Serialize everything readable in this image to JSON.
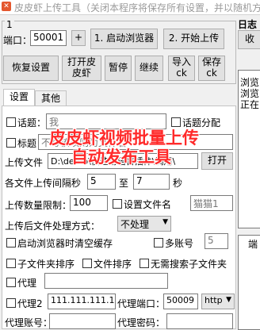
{
  "window": {
    "title": "皮皮虾上传工具（关闭本程序将保存所有设置，并以随机方式"
  },
  "right_panel": {
    "header": "日志",
    "button": "收",
    "log_lines": [
      "浏览",
      "浏览",
      "正在"
    ],
    "bottom_label": "端"
  },
  "toolbar": {
    "index_value": "1",
    "port_label": "端口：",
    "port_value": "50001",
    "plus_label": "+",
    "start_browser_label": "1. 启动浏览器",
    "start_upload_label": "2. 开始上传",
    "restore_label": "恢复设置",
    "open_browser_label": "打开皮\n皮虾",
    "pause_label": "暂停",
    "continue_label": "继续",
    "import_label": "导入\nck",
    "save_label": "保存\nck"
  },
  "tabs": [
    {
      "label": "设置",
      "active": true
    },
    {
      "label": "其他",
      "active": false
    }
  ],
  "settings": {
    "topic_label": "话题：",
    "topic_value": "我",
    "topic_split_label": "话题分配",
    "title_label": "标题",
    "title_hint": "不写该项则为文件名",
    "upload_file_label": "上传文件",
    "upload_path": "D:\\demo\\快速易语言插件\\调用\\",
    "open_button_label": "打开",
    "interval_label": "各文件上传间隔秒",
    "interval_min": "5",
    "interval_to": "至",
    "interval_max": "7",
    "interval_unit": "秒",
    "limit_label": "上传数量限制：",
    "limit_value": "100",
    "set_filename_label": "设置文件名",
    "filename_value": "猫猫1",
    "after_upload_label": "上传后文件处理方式：",
    "after_upload_value": "不处理",
    "clear_cache_label": "启动浏览器时清空缓存",
    "multi_account_label": "多账号",
    "multi_account_value": "5",
    "subfolder_sort_label": "子文件夹排序",
    "file_sort_label": "文件排序",
    "no_search_subfolder_label": "无需搜索子文件夹",
    "proxy_label": "代理",
    "proxy_value": "",
    "proxy2_label": "代理2",
    "proxy2_value": "111.111.111.11",
    "proxy_port_label": "代理端口：",
    "proxy_port_value": "50009",
    "proxy_protocol": "http",
    "proxy_account_label": "代理账号：",
    "proxy_password_label": "代理密码："
  },
  "overlay": {
    "line1": "皮皮虾视频批量上传",
    "line2": "自动发布工具"
  },
  "colors": {
    "overlay_text": "#ff2a2a",
    "window_bg": "#f0f0f0"
  }
}
